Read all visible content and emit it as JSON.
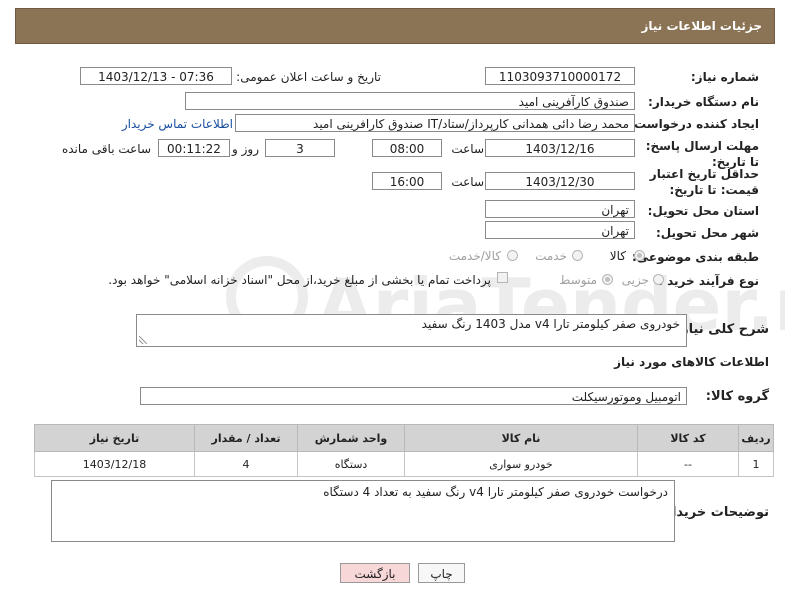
{
  "header": {
    "title": "جزئیات اطلاعات نیاز"
  },
  "fields": {
    "need_number_label": "شماره نیاز:",
    "need_number": "1103093710000172",
    "announce_label": "تاریخ و ساعت اعلان عمومی:",
    "announce_value": "1403/12/13 - 07:36",
    "buyer_label": "نام دستگاه خریدار:",
    "buyer_value": "صندوق کارآفرینی امید",
    "creator_label": "ایجاد کننده درخواست:",
    "creator_value": "محمد رضا دائی همدانی کارپرداز/ستاد/IT صندوق کارافرینی امید",
    "contact_link": "اطلاعات تماس خریدار",
    "deadline_label": "مهلت ارسال پاسخ: تا تاریخ:",
    "deadline_date": "1403/12/16",
    "time_label": "ساعت",
    "deadline_time": "08:00",
    "days_value": "3",
    "days_label": "روز و",
    "remaining_value": "00:11:22",
    "remaining_label": "ساعت باقی مانده",
    "validity_label": "حداقل تاریخ اعتبار قیمت: تا تاریخ:",
    "validity_date": "1403/12/30",
    "validity_time": "16:00",
    "province_label": "استان محل تحویل:",
    "province_value": "تهران",
    "city_label": "شهر محل تحویل:",
    "city_value": "تهران",
    "category_label": "طبقه بندی موضوعی:",
    "category_options": [
      "کالا",
      "خدمت",
      "کالا/خدمت"
    ],
    "process_label": "نوع فرآیند خرید :",
    "process_options": [
      "جزیی",
      "متوسط"
    ],
    "payment_note": "پرداخت تمام یا بخشی از مبلغ خرید،از محل \"اسناد خزانه اسلامی\" خواهد بود."
  },
  "description": {
    "label": "شرح کلی نیاز:",
    "value": "خودروی صفر کیلومتر تارا v4 مدل 1403  رنگ سفید"
  },
  "goods_info": {
    "title": "اطلاعات کالاهای مورد نیاز",
    "group_label": "گروه کالا:",
    "group_value": "اتومبیل وموتورسیکلت"
  },
  "table": {
    "headers": [
      "ردیف",
      "کد کالا",
      "نام کالا",
      "واحد شمارش",
      "تعداد / مقدار",
      "تاریخ نیاز"
    ],
    "rows": [
      [
        "1",
        "--",
        "خودرو سواری",
        "دستگاه",
        "4",
        "1403/12/18"
      ]
    ]
  },
  "buyer_notes": {
    "label": "توضیحات خریدار:",
    "value": "درخواست خودروی صفر کیلومتر تارا v4 رنگ سفید به تعداد 4 دستگاه"
  },
  "buttons": {
    "print": "چاپ",
    "back": "بازگشت"
  },
  "watermark_text": "AriaTender.net",
  "colors": {
    "header_bg": "#8b7355",
    "link": "#1a4fa0",
    "back_button": "#f7d7d7"
  }
}
